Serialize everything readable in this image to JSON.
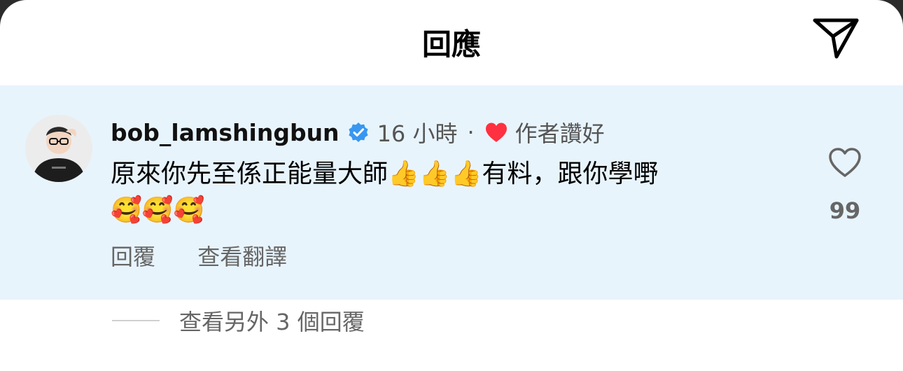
{
  "header": {
    "title": "回應",
    "share_icon": "paper-plane-icon"
  },
  "comment": {
    "username": "bob_lamshingbun",
    "verified_icon": "verified-badge-icon",
    "time": "16 小時",
    "separator": "·",
    "liked_by_author": "作者讚好",
    "text_line1": "原來你先至係正能量大師👍👍👍有料，跟你學嘢",
    "text_line2": "🥰🥰🥰",
    "actions": {
      "reply": "回覆",
      "translate": "查看翻譯"
    },
    "like_count": "99"
  },
  "more_replies": {
    "label": "查看另外 3 個回覆"
  },
  "colors": {
    "highlight_bg": "#e8f4fc",
    "verified_blue": "#3897f0",
    "heart_red": "#ff3040"
  }
}
